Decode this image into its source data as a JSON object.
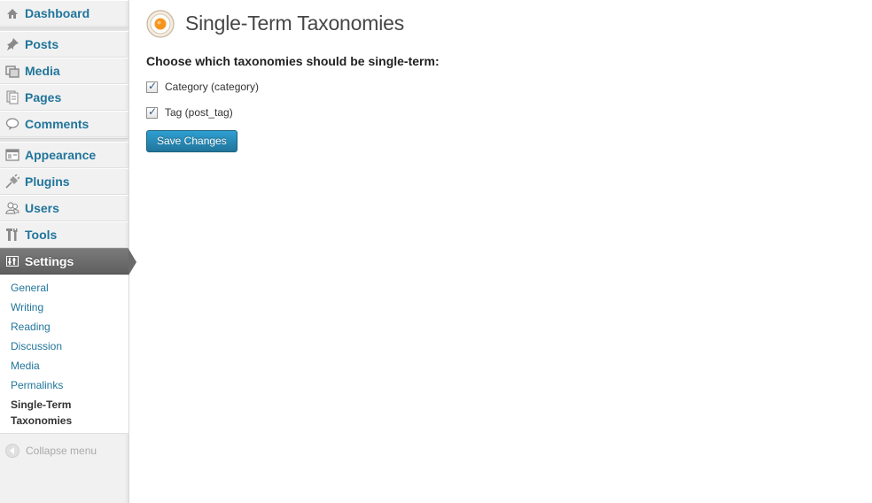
{
  "sidebar": {
    "items": [
      {
        "id": "dashboard",
        "label": "Dashboard",
        "icon": "dashboard-icon"
      },
      {
        "id": "posts",
        "label": "Posts",
        "icon": "pushpin-icon"
      },
      {
        "id": "media",
        "label": "Media",
        "icon": "media-icon"
      },
      {
        "id": "pages",
        "label": "Pages",
        "icon": "pages-icon"
      },
      {
        "id": "comments",
        "label": "Comments",
        "icon": "comment-bubble-icon"
      },
      {
        "id": "appearance",
        "label": "Appearance",
        "icon": "appearance-icon"
      },
      {
        "id": "plugins",
        "label": "Plugins",
        "icon": "plug-icon"
      },
      {
        "id": "users",
        "label": "Users",
        "icon": "users-icon"
      },
      {
        "id": "tools",
        "label": "Tools",
        "icon": "tools-icon"
      },
      {
        "id": "settings",
        "label": "Settings",
        "icon": "settings-icon",
        "current": true
      }
    ],
    "submenu": [
      {
        "label": "General"
      },
      {
        "label": "Writing"
      },
      {
        "label": "Reading"
      },
      {
        "label": "Discussion"
      },
      {
        "label": "Media"
      },
      {
        "label": "Permalinks"
      },
      {
        "label": "Single-Term Taxonomies",
        "current": true
      }
    ],
    "collapse_label": "Collapse menu"
  },
  "main": {
    "title": "Single-Term Taxonomies",
    "icon": "target-circle-icon",
    "heading": "Choose which taxonomies should be single-term:",
    "taxonomies": [
      {
        "label": "Category (category)",
        "checked": true
      },
      {
        "label": "Tag (post_tag)",
        "checked": true
      }
    ],
    "save_label": "Save Changes"
  },
  "colors": {
    "link": "#21759b",
    "button": "#21759b",
    "current_menu": "#6b6b6b"
  }
}
